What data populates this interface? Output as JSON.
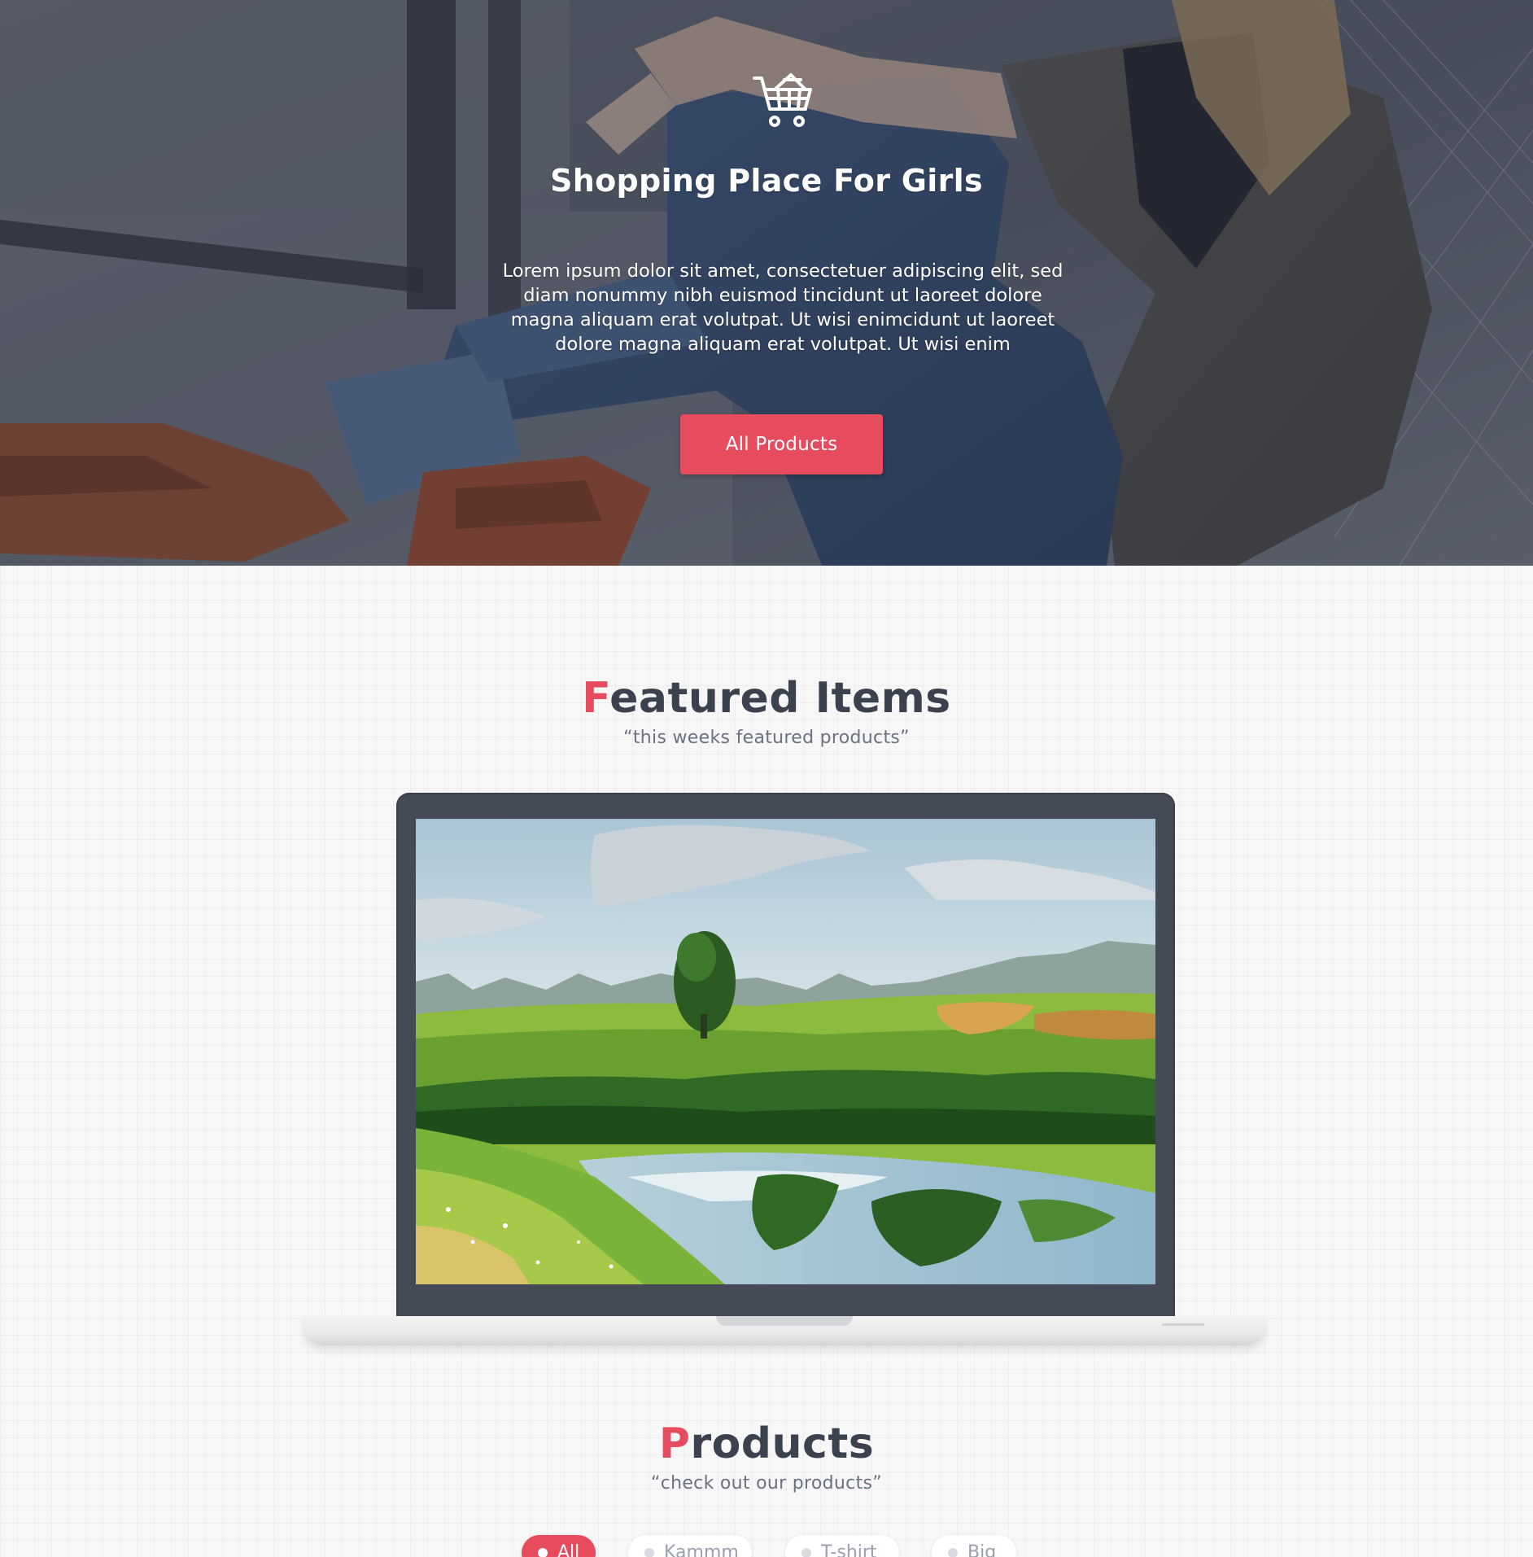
{
  "hero": {
    "icon": "shopping-cart-icon",
    "title": "Shopping Place For Girls",
    "text": "Lorem ipsum dolor sit amet, consectetuer adipiscing elit, sed diam nonummy nibh euismod tincidunt ut laoreet dolore magna aliquam erat volutpat. Ut wisi enimcidunt ut laoreet dolore magna aliquam erat volutpat. Ut wisi enim",
    "button_label": "All Products"
  },
  "featured": {
    "title_first": "F",
    "title_rest": "eatured Items",
    "subtitle": "“this weeks featured products”"
  },
  "products": {
    "title_first": "P",
    "title_rest": "roducts",
    "subtitle": "“check out our products”",
    "filters": [
      {
        "label": "All",
        "active": true
      },
      {
        "label": "Kammm",
        "active": false
      },
      {
        "label": "T-shirt",
        "active": false
      },
      {
        "label": "Big",
        "active": false
      }
    ]
  },
  "colors": {
    "accent": "#e74c5e",
    "heading": "#3c4150",
    "laptop_frame": "#454a57"
  }
}
